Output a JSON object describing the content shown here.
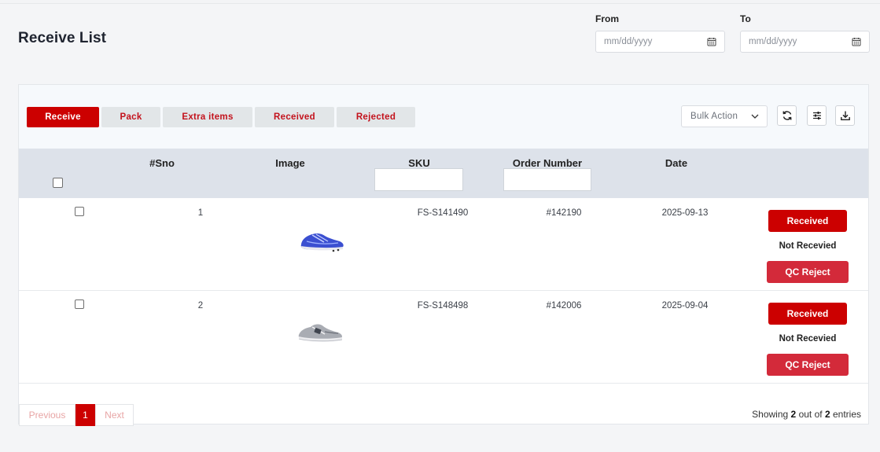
{
  "header": {
    "title": "Receive List",
    "from_label": "From",
    "to_label": "To",
    "date_placeholder": "mm/dd/yyyy"
  },
  "tabs": [
    {
      "label": "Receive",
      "active": true
    },
    {
      "label": "Pack",
      "active": false
    },
    {
      "label": "Extra items",
      "active": false
    },
    {
      "label": "Received",
      "active": false
    },
    {
      "label": "Rejected",
      "active": false
    }
  ],
  "toolbar": {
    "bulk_action_label": "Bulk Action",
    "icons": [
      "refresh-icon",
      "filter-sliders-icon",
      "download-icon"
    ]
  },
  "table": {
    "columns": [
      "#Sno",
      "Image",
      "SKU",
      "Order Number",
      "Date"
    ],
    "rows": [
      {
        "sno": "1",
        "sku": "FS-S141490",
        "order": "#142190",
        "date": "2025-09-13",
        "image": "blue running shoe",
        "received_label": "Received",
        "status": "Not Recevied",
        "reject_label": "QC Reject"
      },
      {
        "sno": "2",
        "sku": "FS-S148498",
        "order": "#142006",
        "date": "2025-09-04",
        "image": "grey sneaker",
        "received_label": "Received",
        "status": "Not Recevied",
        "reject_label": "QC Reject"
      }
    ]
  },
  "pagination": {
    "previous_label": "Previous",
    "current_page": "1",
    "next_label": "Next",
    "showing_prefix": "Showing",
    "shown": "2",
    "out_of": "out of",
    "total": "2",
    "entries": "entries"
  },
  "colors": {
    "accent": "#cc0000",
    "qc_reject": "#d32a3a",
    "tab_bg": "#e2e6e8",
    "table_header_bg": "#dde2ea"
  }
}
